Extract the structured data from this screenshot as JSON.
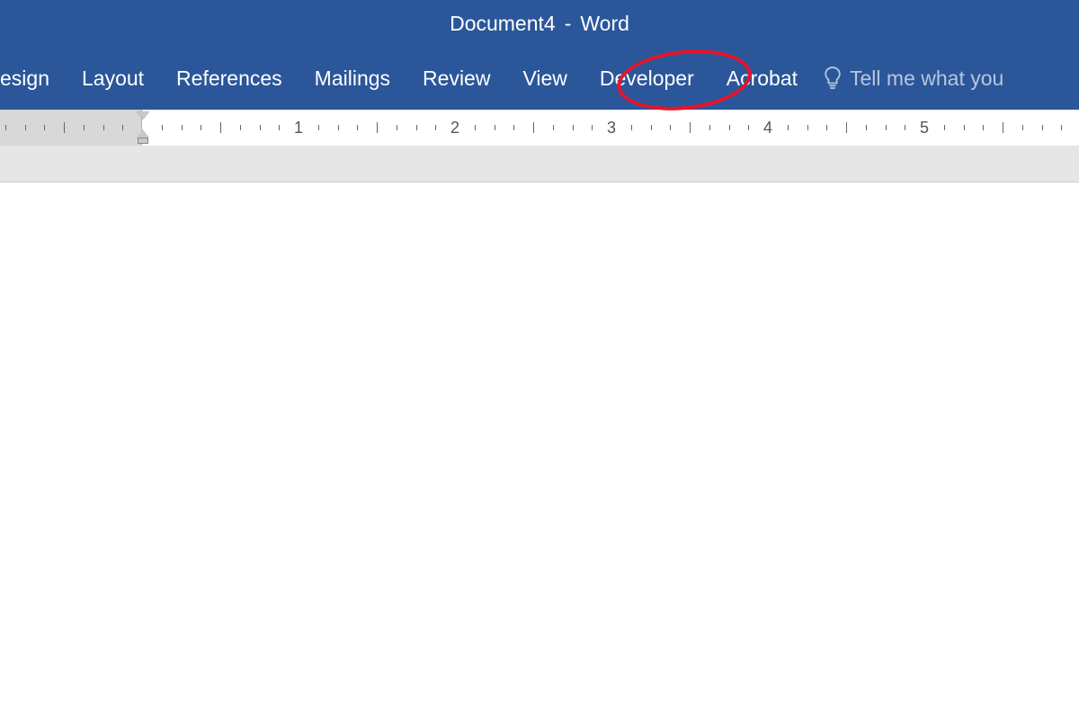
{
  "title": {
    "document": "Document4",
    "separator": "-",
    "app": "Word"
  },
  "tabs": {
    "t0": "esign",
    "t1": "Layout",
    "t2": "References",
    "t3": "Mailings",
    "t4": "Review",
    "t5": "View",
    "t6": "Developer",
    "t7": "Acrobat"
  },
  "tellme": {
    "placeholder": "Tell me what you"
  },
  "ruler": {
    "numbers": {
      "n1": "1",
      "n2": "2",
      "n3": "3",
      "n4": "4",
      "n5": "5"
    }
  },
  "annotation": {
    "highlighted_tab": "Developer"
  }
}
